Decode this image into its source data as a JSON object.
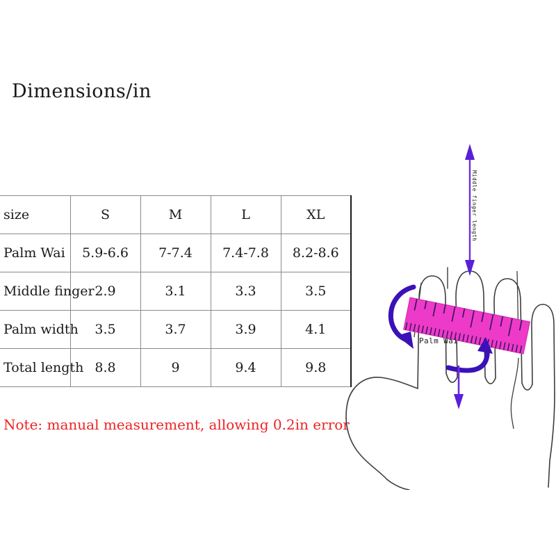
{
  "title": "Dimensions/in",
  "table": {
    "columns": [
      "size",
      "S",
      "M",
      "L",
      "XL"
    ],
    "rows": [
      {
        "label": "Palm Wai",
        "values": [
          "5.9-6.6",
          "7-7.4",
          "7.4-7.8",
          "8.2-8.6"
        ]
      },
      {
        "label": "Middle finger",
        "values": [
          "2.9",
          "3.1",
          "3.3",
          "3.5"
        ]
      },
      {
        "label": "Palm width",
        "values": [
          "3.5",
          "3.7",
          "3.9",
          "4.1"
        ]
      },
      {
        "label": "Total length",
        "values": [
          "8.8",
          "9",
          "9.4",
          "9.8"
        ]
      }
    ]
  },
  "note": "Note: manual measurement, allowing 0.2in error",
  "diagram": {
    "middle_finger_label": "Middle finger length",
    "palm_label": "Palm Wai",
    "colors": {
      "ruler": "#ee3ac8",
      "ruler_tick": "#3a1560",
      "arrow_blue": "#3b12b8",
      "arrow_purple": "#6a2de0",
      "hand_outline": "#3c3c3c"
    }
  },
  "colors": {
    "note_red": "#ee2222",
    "table_border": "#8a8a8a",
    "text": "#1a1a1a",
    "background": "#ffffff"
  }
}
